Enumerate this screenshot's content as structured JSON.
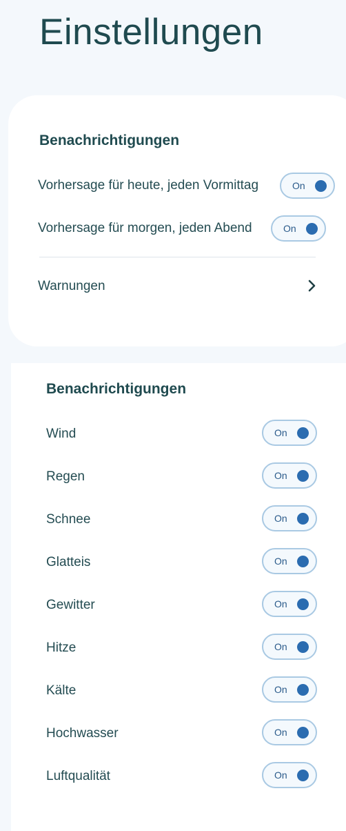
{
  "title": "Einstellungen",
  "section1": {
    "heading": "Benachrichtigungen",
    "rows": [
      {
        "label": "Vorhersage für heute, jeden Vormittag",
        "toggle": "On"
      },
      {
        "label": "Vorhersage für morgen, jeden Abend",
        "toggle": "On"
      }
    ],
    "link_label": "Warnungen",
    "link_icon": "chevron-right-icon"
  },
  "section2": {
    "heading": "Benachrichtigungen",
    "rows": [
      {
        "label": "Wind",
        "toggle": "On"
      },
      {
        "label": "Regen",
        "toggle": "On"
      },
      {
        "label": "Schnee",
        "toggle": "On"
      },
      {
        "label": "Glatteis",
        "toggle": "On"
      },
      {
        "label": "Gewitter",
        "toggle": "On"
      },
      {
        "label": "Hitze",
        "toggle": "On"
      },
      {
        "label": "Kälte",
        "toggle": "On"
      },
      {
        "label": "Hochwasser",
        "toggle": "On"
      },
      {
        "label": "Luftqualität",
        "toggle": "On"
      }
    ]
  },
  "colors": {
    "text": "#1f4a4f",
    "toggle_border": "#a9c9e3",
    "toggle_knob": "#2b6cb0",
    "background": "#f4f8fc"
  }
}
